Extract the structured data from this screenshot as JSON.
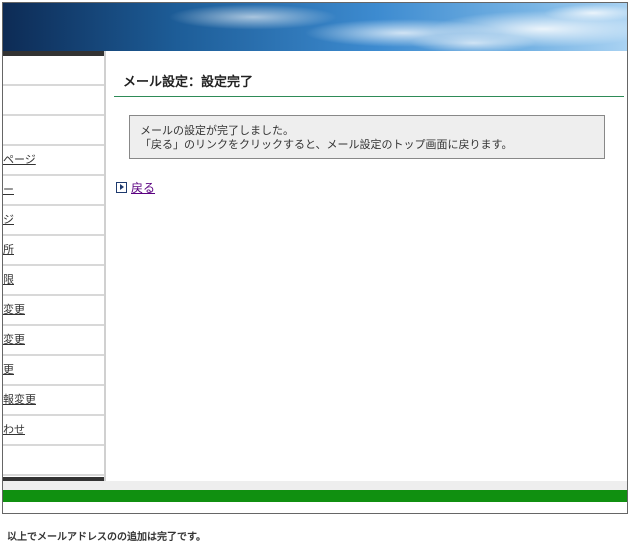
{
  "header": {
    "banner": "sky-banner"
  },
  "sidebar": {
    "items": [
      {
        "label": ""
      },
      {
        "label": ""
      },
      {
        "label": ""
      },
      {
        "label": "ページ"
      },
      {
        "label": "ー"
      },
      {
        "label": "ジ"
      },
      {
        "label": "所"
      },
      {
        "label": "限"
      },
      {
        "label": "変更"
      },
      {
        "label": "変更"
      },
      {
        "label": "更"
      },
      {
        "label": "報変更"
      },
      {
        "label": "わせ"
      },
      {
        "label": ""
      }
    ]
  },
  "main": {
    "title": "メール設定：設定完了",
    "message_line1": "メールの設定が完了しました。",
    "message_line2": "「戻る」のリンクをクリックすると、メール設定のトップ画面に戻ります。",
    "back_link": "戻る",
    "back_icon": "right-arrow-box-icon"
  },
  "caption": "以上でメールアドレスのの追加は完了です。",
  "colors": {
    "footer_green": "#109010",
    "title_rule": "#2e8b57",
    "link": "#5a0080"
  }
}
